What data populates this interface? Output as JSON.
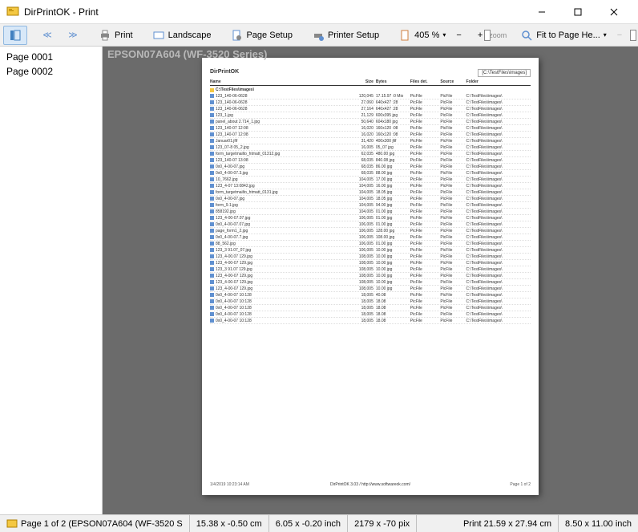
{
  "window": {
    "title": "DirPrintOK - Print"
  },
  "toolbar": {
    "print": "Print",
    "landscape": "Landscape",
    "page_setup": "Page Setup",
    "printer_setup": "Printer Setup",
    "zoom_value": "405 %",
    "fit_label": "Fit to Page He...",
    "zoom_tag": "zoom"
  },
  "sidebar": {
    "pages": [
      "Page 0001",
      "Page 0002"
    ]
  },
  "preview": {
    "printer_name": "EPSON07A604 (WF-3520 Series)",
    "sheet_title": "DirPrintOK",
    "sheet_path": "[C:\\TestFiles\\images]",
    "columns": [
      "Name",
      "Size",
      "Bytes",
      "Files det.",
      "Source",
      "Folder"
    ],
    "root_folder": "C:\\TestFiles\\images\\",
    "rows": [
      {
        "name": "123_140-06-0628",
        "size": "120,045",
        "bytes": "17.15.97 :0 Mio",
        "files": "PicFile",
        "source": "C:\\TestFiles\\images\\"
      },
      {
        "name": "123_140-06-0628",
        "size": "27,060",
        "bytes": "640x427 :28",
        "files": "PicFile",
        "source": "C:\\TestFiles\\images\\"
      },
      {
        "name": "123_140-06-0628",
        "size": "27,164",
        "bytes": "640x427 :28",
        "files": "PicFile",
        "source": "C:\\TestFiles\\images\\"
      },
      {
        "name": "123_1.jpg",
        "size": "21,129",
        "bytes": "600x395 jpg",
        "files": "PicFile",
        "source": "C:\\TestFiles\\images\\"
      },
      {
        "name": "panel_about 2.714_1.jpg",
        "size": "50,640",
        "bytes": "604x180 jpg",
        "files": "PicFile",
        "source": "C:\\TestFiles\\images\\"
      },
      {
        "name": "123_140-07 12:08",
        "size": "16,020",
        "bytes": "160x120 :08",
        "files": "PicFile",
        "source": "C:\\TestFiles\\images\\"
      },
      {
        "name": "123_140-07 12:08",
        "size": "16,020",
        "bytes": "160x120 :08",
        "files": "PicFile",
        "source": "C:\\TestFiles\\images\\"
      },
      {
        "name": "Januar01.jfif",
        "size": "31,420",
        "bytes": "400x300 jfif",
        "files": "PicFile",
        "source": "C:\\TestFiles\\images\\"
      },
      {
        "name": "123_07-8 05_2.jpg",
        "size": "16,005",
        "bytes": "05_07 jpg",
        "files": "PicFile",
        "source": "C:\\TestFiles\\images\\"
      },
      {
        "name": "form_targetmailto_htmatt_01312.jpg",
        "size": "62,035",
        "bytes": "480.00 jpg",
        "files": "PicFile",
        "source": "C:\\TestFiles\\images\\"
      },
      {
        "name": "123_140-07 13:08",
        "size": "68,035",
        "bytes": "840.08 jpg",
        "files": "PicFile",
        "source": "C:\\TestFiles\\images\\"
      },
      {
        "name": "0x0_4-00-07.jpg",
        "size": "68,035",
        "bytes": "86.00 jpg",
        "files": "PicFile",
        "source": "C:\\TestFiles\\images\\"
      },
      {
        "name": "0x0_4-00-07.3.jpg",
        "size": "68,035",
        "bytes": "88.00 jpg",
        "files": "PicFile",
        "source": "C:\\TestFiles\\images\\"
      },
      {
        "name": "10_7662.jpg",
        "size": "104,005",
        "bytes": "17.00 jpg",
        "files": "PicFile",
        "source": "C:\\TestFiles\\images\\"
      },
      {
        "name": "123_4-07 13:0842.jpg",
        "size": "104,005",
        "bytes": "16.00 jpg",
        "files": "PicFile",
        "source": "C:\\TestFiles\\images\\"
      },
      {
        "name": "form_targetmailto_htmatt_0131.jpg",
        "size": "104,005",
        "bytes": "18.05 jpg",
        "files": "PicFile",
        "source": "C:\\TestFiles\\images\\"
      },
      {
        "name": "0x0_4-00-07.jpg",
        "size": "104,005",
        "bytes": "18.05 jpg",
        "files": "PicFile",
        "source": "C:\\TestFiles\\images\\"
      },
      {
        "name": "form_9.1.jpg",
        "size": "104,005",
        "bytes": "94.00 jpg",
        "files": "PicFile",
        "source": "C:\\TestFiles\\images\\"
      },
      {
        "name": "858192.jpg",
        "size": "104,005",
        "bytes": "01.00 jpg",
        "files": "PicFile",
        "source": "C:\\TestFiles\\images\\"
      },
      {
        "name": "123_4-00-07.07.jpg",
        "size": "106,005",
        "bytes": "01.00 jpg",
        "files": "PicFile",
        "source": "C:\\TestFiles\\images\\"
      },
      {
        "name": "0x0_4-00-07.07.jpg",
        "size": "106,005",
        "bytes": "01.00 jpg",
        "files": "PicFile",
        "source": "C:\\TestFiles\\images\\"
      },
      {
        "name": "page_form1_2.jpg",
        "size": "106,005",
        "bytes": "128.00 jpg",
        "files": "PicFile",
        "source": "C:\\TestFiles\\images\\"
      },
      {
        "name": "0x0_4-00-07.7.jpg",
        "size": "106,005",
        "bytes": "108.00 jpg",
        "files": "PicFile",
        "source": "C:\\TestFiles\\images\\"
      },
      {
        "name": "88_562.jpg",
        "size": "106,005",
        "bytes": "01.00 jpg",
        "files": "PicFile",
        "source": "C:\\TestFiles\\images\\"
      },
      {
        "name": "123_3 91.07_07.jpg",
        "size": "106,005",
        "bytes": "10.00 jpg",
        "files": "PicFile",
        "source": "C:\\TestFiles\\images\\"
      },
      {
        "name": "123_4-00.07 129.jpg",
        "size": "108,005",
        "bytes": "10.00 jpg",
        "files": "PicFile",
        "source": "C:\\TestFiles\\images\\"
      },
      {
        "name": "123_4-00-07 129.jpg",
        "size": "108,005",
        "bytes": "10.00 jpg",
        "files": "PicFile",
        "source": "C:\\TestFiles\\images\\"
      },
      {
        "name": "123_3 91.07 129.jpg",
        "size": "108,005",
        "bytes": "10.00 jpg",
        "files": "PicFile",
        "source": "C:\\TestFiles\\images\\"
      },
      {
        "name": "123_4-00-07 129.jpg",
        "size": "108,005",
        "bytes": "10.00 jpg",
        "files": "PicFile",
        "source": "C:\\TestFiles\\images\\"
      },
      {
        "name": "123_4-00-07 129.jpg",
        "size": "108,005",
        "bytes": "10.00 jpg",
        "files": "PicFile",
        "source": "C:\\TestFiles\\images\\"
      },
      {
        "name": "123_4-00-07 129.jpg",
        "size": "108,005",
        "bytes": "10.00 jpg",
        "files": "PicFile",
        "source": "C:\\TestFiles\\images\\"
      },
      {
        "name": "0x0_4-00-07 10:128",
        "size": "18,005",
        "bytes": "40.08",
        "files": "PicFile",
        "source": "C:\\TestFiles\\images\\"
      },
      {
        "name": "0x0_4-00-07 10:128",
        "size": "18,005",
        "bytes": "18.08",
        "files": "PicFile",
        "source": "C:\\TestFiles\\images\\"
      },
      {
        "name": "0x0_4-00-07 10:128",
        "size": "18,005",
        "bytes": "18.08",
        "files": "PicFile",
        "source": "C:\\TestFiles\\images\\"
      },
      {
        "name": "0x0_4-00-07 10:128",
        "size": "18,005",
        "bytes": "18.08",
        "files": "PicFile",
        "source": "C:\\TestFiles\\images\\"
      },
      {
        "name": "0x0_4-00-07 10:128",
        "size": "18,005",
        "bytes": "18.08",
        "files": "PicFile",
        "source": "C:\\TestFiles\\images\\"
      }
    ],
    "footer_date": "1/4/2019 10:23:14 AM",
    "footer_app": "DirPrintOK 3.03 / http://www.softwareok.com/",
    "footer_page": "Page 1 of 2"
  },
  "statusbar": {
    "page_info": "Page 1 of 2 (EPSON07A604 (WF-3520 S",
    "cm": "15.38 x -0.50 cm",
    "inch": "6.05 x -0.20 inch",
    "pix": "2179 x -70 pix",
    "print_cm": "Print 21.59 x 27.94 cm",
    "print_inch": "8.50 x 11.00 inch"
  }
}
